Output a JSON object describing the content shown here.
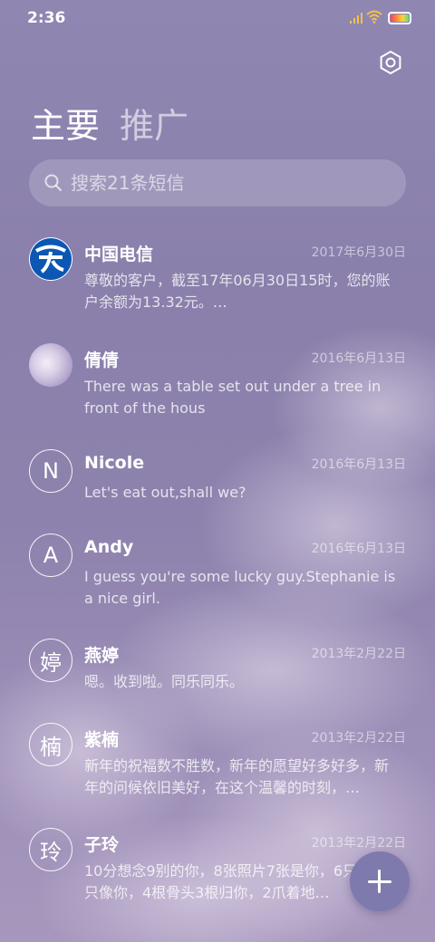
{
  "status_bar": {
    "time": "2:36"
  },
  "header": {
    "tabs": [
      {
        "label": "主要",
        "active": true
      },
      {
        "label": "推广",
        "active": false
      }
    ],
    "settings_icon": "settings-gear-icon"
  },
  "search": {
    "placeholder": "搜索21条短信",
    "icon": "search-icon"
  },
  "conversations": [
    {
      "name": "中国电信",
      "date": "2017年6月30日",
      "preview": "尊敬的客户，截至17年06月30日15时，您的账户余额为13.32元。…",
      "avatar": "china-telecom-logo"
    },
    {
      "name": "倩倩",
      "date": "2016年6月13日",
      "preview": "There was a table set out under a tree in front of the hous",
      "avatar": "cloud-photo"
    },
    {
      "name": "Nicole",
      "date": "2016年6月13日",
      "preview": "Let's eat out,shall we?",
      "avatar_letter": "N"
    },
    {
      "name": "Andy",
      "date": "2016年6月13日",
      "preview": "I guess you're some lucky guy.Stephanie is a nice girl.",
      "avatar_letter": "A"
    },
    {
      "name": "燕婷",
      "date": "2013年2月22日",
      "preview": "嗯。收到啦。同乐同乐。",
      "avatar_letter": "婷"
    },
    {
      "name": "紫楠",
      "date": "2013年2月22日",
      "preview": "新年的祝福数不胜数，新年的愿望好多好多，新年的问候依旧美好，在这个温馨的时刻，…",
      "avatar_letter": "楠"
    },
    {
      "name": "子玲",
      "date": "2013年2月22日",
      "preview": "10分想念9别的你，8张照片7张是你，6只小狗5只像你，4根骨头3根归你，2爪着地…",
      "avatar_letter": "玲"
    }
  ],
  "fab": {
    "icon": "plus-icon"
  }
}
